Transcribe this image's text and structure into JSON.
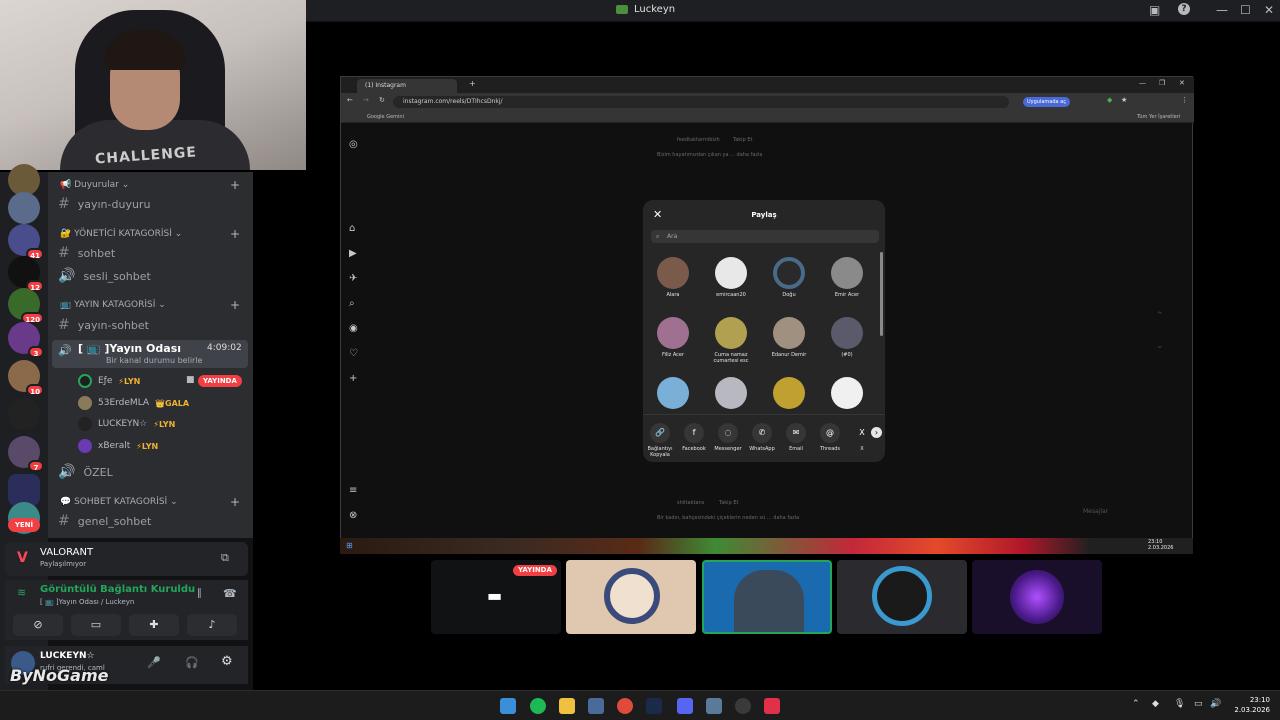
{
  "window": {
    "title": "Luckeyn"
  },
  "webcam": {
    "shirt_text": "CHALLENGE"
  },
  "rail": {
    "badges": [
      "41",
      "12",
      "120",
      "3",
      "10",
      "7"
    ],
    "new_label": "YENİ"
  },
  "channels": {
    "duyurular_cat": "Duyurular",
    "yayin_duyuru": "yayın-duyuru",
    "yonetici_cat": "YÖNETİCİ KATAGORİSİ",
    "sohbet": "sohbet",
    "sesli_sohbet": "sesli_sohbet",
    "yayin_cat": "YAYIN KATAGORİSİ",
    "yayin_sohbet": "yayın-sohbet",
    "voice_room": "[ 📺 ]Yayın Odası",
    "voice_status": "Bir kanal durumu belirle",
    "voice_time": "4:09:02",
    "users": [
      {
        "name": "Eƒe",
        "tag": "⚡LYN",
        "live": "YAYINDA"
      },
      {
        "name": "53ErdeMLA",
        "tag": "👑GALA"
      },
      {
        "name": "LUCKEYN☆",
        "tag": "⚡LYN"
      },
      {
        "name": "xBeralt",
        "tag": "⚡LYN"
      }
    ],
    "ozel": "ÖZEL",
    "sohbet_cat": "SOHBET KATAGORİSİ",
    "genel_sohbet": "genel_sohbet"
  },
  "activity": {
    "game": "VALORANT",
    "status": "Paylaşılmıyor"
  },
  "voice_panel": {
    "status": "Görüntülü Bağlantı Kuruldu",
    "channel": "[ 📺 ]Yayın Odası / Luckeyn"
  },
  "user_panel": {
    "name": "LUCKEYN☆",
    "status": "rufri gerendi, caml",
    "watermark": "ByNoGame"
  },
  "browser": {
    "tab_title": "(1) Instagram",
    "url": "instagram.com/reels/DTIhcsDnkj/",
    "apps_button": "Uygulamada aç",
    "bookmark": "Google Gemini",
    "all_bookmarks": "Tüm Yer İşaretleri",
    "bg_user1": "feedtaktarmibizh",
    "bg_follow": "Takip Et",
    "bg_caption1": "Bizim hayatımızdan çıkan ya ... daha fazla",
    "bg_user2": "shiltaktans",
    "bg_caption2": "Bir kadın, bahçesindeki çiçeklerin neden sü ... daha fazla",
    "messages": "Mesajlar"
  },
  "dialog": {
    "title": "Paylaş",
    "search_placeholder": "Ara",
    "people": [
      {
        "name": "Alara"
      },
      {
        "name": "emircaan20"
      },
      {
        "name": "Doğu"
      },
      {
        "name": "Emir Acer"
      },
      {
        "name": "Filiz Acer"
      },
      {
        "name": "Cuma namaz cumartesi esc"
      },
      {
        "name": "Edanur Demir"
      },
      {
        "name": "(#0)"
      },
      {
        "name": ""
      },
      {
        "name": ""
      },
      {
        "name": ""
      },
      {
        "name": ""
      }
    ],
    "share": [
      "Bağlantıyı Kopyala",
      "Facebook",
      "Messenger",
      "WhatsApp",
      "Email",
      "Threads",
      "X"
    ]
  },
  "stream_taskbar": {
    "time": "23:10",
    "date": "2.03.2026"
  },
  "tiles": {
    "live_label": "YAYINDA"
  },
  "taskbar": {
    "time": "23:10",
    "date": "2.03.2026"
  }
}
